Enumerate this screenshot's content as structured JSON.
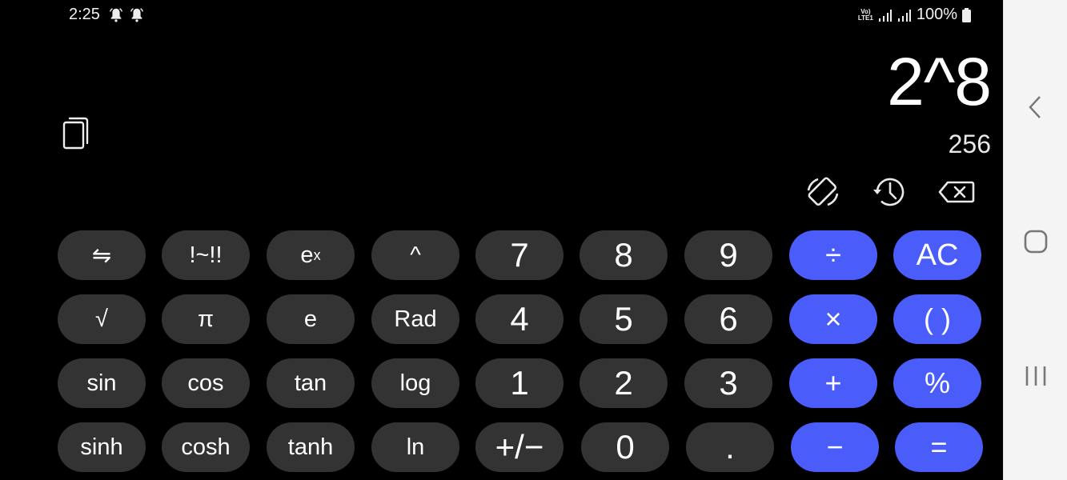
{
  "status_bar": {
    "time": "2:25",
    "notification_icons": [
      "bell-icon",
      "bell-icon"
    ],
    "network_label": "VoLTE1",
    "battery": "100%"
  },
  "display": {
    "expression": "2^8",
    "result": "256"
  },
  "toolbar": {
    "icons": [
      "rotate-screen-icon",
      "history-icon",
      "backspace-icon"
    ]
  },
  "colors": {
    "background": "#000000",
    "key_dark": "#333333",
    "key_accent": "#4a5cfa",
    "nav_bar": "#f4f4f4"
  },
  "keypad": {
    "rows": [
      [
        {
          "label": "⇋",
          "name": "toggle-functions-button"
        },
        {
          "label": "!~!!",
          "name": "factorial-button"
        },
        {
          "label": "e",
          "sup": "x",
          "name": "exp-button"
        },
        {
          "label": "^",
          "name": "power-button"
        },
        {
          "label": "7",
          "name": "digit-7-button"
        },
        {
          "label": "8",
          "name": "digit-8-button"
        },
        {
          "label": "9",
          "name": "digit-9-button"
        },
        {
          "label": "÷",
          "name": "divide-button"
        },
        {
          "label": "AC",
          "name": "clear-button"
        }
      ],
      [
        {
          "label": "√",
          "name": "sqrt-button"
        },
        {
          "label": "π",
          "name": "pi-button"
        },
        {
          "label": "e",
          "name": "euler-button"
        },
        {
          "label": "Rad",
          "name": "rad-button"
        },
        {
          "label": "4",
          "name": "digit-4-button"
        },
        {
          "label": "5",
          "name": "digit-5-button"
        },
        {
          "label": "6",
          "name": "digit-6-button"
        },
        {
          "label": "×",
          "name": "multiply-button"
        },
        {
          "label": "( )",
          "name": "parentheses-button"
        }
      ],
      [
        {
          "label": "sin",
          "name": "sin-button"
        },
        {
          "label": "cos",
          "name": "cos-button"
        },
        {
          "label": "tan",
          "name": "tan-button"
        },
        {
          "label": "log",
          "name": "log-button"
        },
        {
          "label": "1",
          "name": "digit-1-button"
        },
        {
          "label": "2",
          "name": "digit-2-button"
        },
        {
          "label": "3",
          "name": "digit-3-button"
        },
        {
          "label": "+",
          "name": "add-button"
        },
        {
          "label": "%",
          "name": "percent-button"
        }
      ],
      [
        {
          "label": "sinh",
          "name": "sinh-button"
        },
        {
          "label": "cosh",
          "name": "cosh-button"
        },
        {
          "label": "tanh",
          "name": "tanh-button"
        },
        {
          "label": "ln",
          "name": "ln-button"
        },
        {
          "label": "+/−",
          "name": "negate-button"
        },
        {
          "label": "0",
          "name": "digit-0-button"
        },
        {
          "label": ".",
          "name": "decimal-button"
        },
        {
          "label": "−",
          "name": "subtract-button"
        },
        {
          "label": "=",
          "name": "equals-button"
        }
      ]
    ]
  },
  "nav_bar": {
    "icons": [
      "back-icon",
      "home-icon",
      "recents-icon"
    ]
  }
}
